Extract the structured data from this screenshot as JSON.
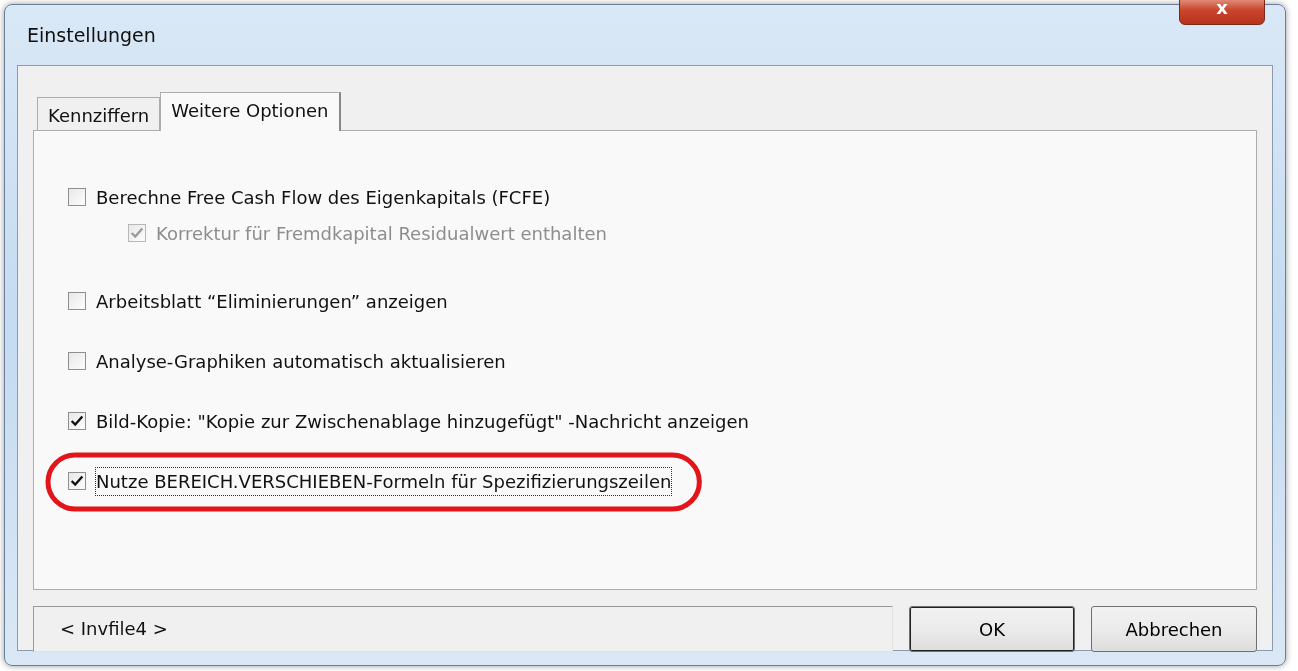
{
  "window": {
    "title": "Einstellungen",
    "close": "x"
  },
  "tabs": [
    {
      "label": "Kennziffern",
      "selected": false
    },
    {
      "label": "Weitere Optionen",
      "selected": true
    }
  ],
  "options": [
    {
      "label": "Berechne Free Cash Flow des Eigenkapitals (FCFE)",
      "checked": false,
      "disabled": false,
      "children": [
        {
          "label": "Korrektur für Fremdkapital Residualwert enthalten",
          "checked": true,
          "disabled": true
        }
      ]
    },
    {
      "label": "Arbeitsblatt “Eliminierungen” anzeigen",
      "checked": false,
      "disabled": false
    },
    {
      "label": "Analyse-Graphiken automatisch aktualisieren",
      "checked": false,
      "disabled": false
    },
    {
      "label": "Bild-Kopie: \"Kopie zur Zwischenablage hinzugefügt\" -Nachricht anzeigen",
      "checked": true,
      "disabled": false
    },
    {
      "label": "Nutze BEREICH.VERSCHIEBEN-Formeln für Spezifizierungszeilen",
      "checked": true,
      "disabled": false,
      "focused": true,
      "highlighted": true
    }
  ],
  "status_field": {
    "value": "< Invfile4 >"
  },
  "buttons": [
    "OK",
    "Abbrechen"
  ]
}
